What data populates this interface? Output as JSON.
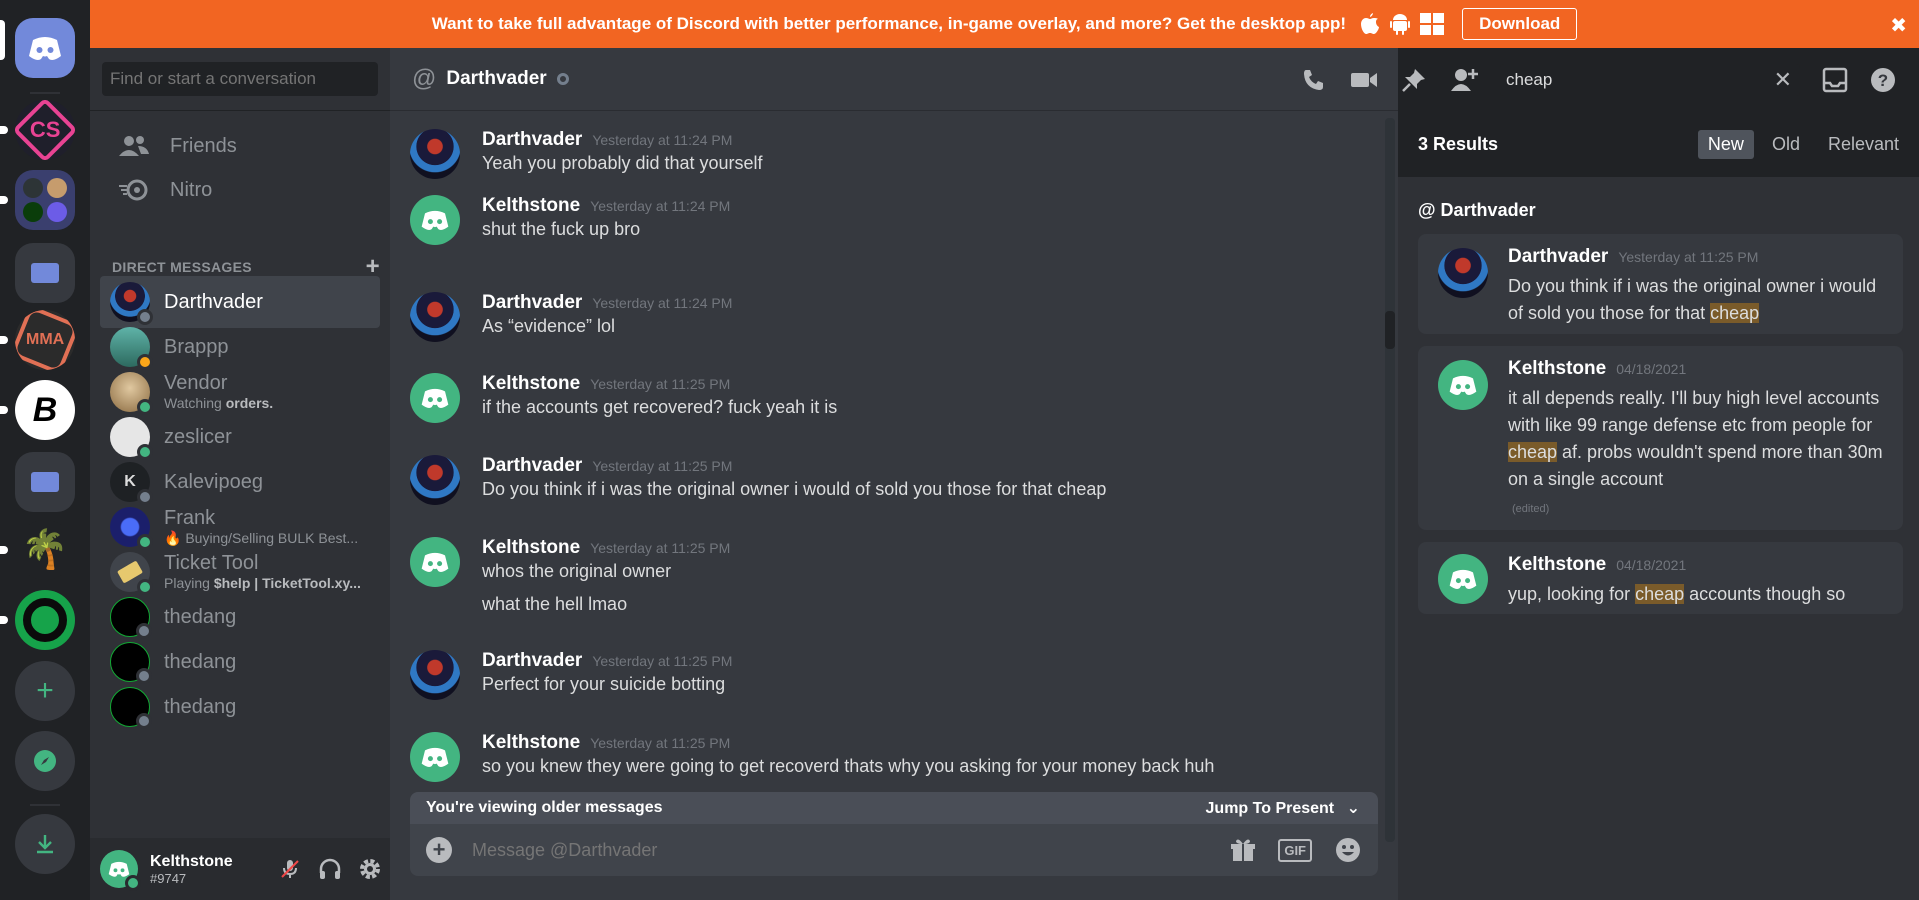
{
  "banner": {
    "text": "Want to take full advantage of Discord with better performance, in-game overlay, and more? Get the desktop app!",
    "download_label": "Download",
    "close_glyph": "✖"
  },
  "guilds": {
    "items": [
      {
        "name": "home"
      },
      {
        "name": "CS",
        "label": "CS"
      },
      {
        "name": "folder-grid"
      },
      {
        "name": "folder"
      },
      {
        "name": "MMA",
        "label": "MMA"
      },
      {
        "name": "B",
        "label": "B"
      },
      {
        "name": "folder-2"
      },
      {
        "name": "palm"
      },
      {
        "name": "ring"
      }
    ],
    "add_glyph": "+",
    "explore_icon": "compass-icon",
    "download_icon": "download-icon"
  },
  "sidebar": {
    "search_placeholder": "Find or start a conversation",
    "friends_label": "Friends",
    "nitro_label": "Nitro",
    "dm_header": "DIRECT MESSAGES",
    "dm_add": "+",
    "dms": [
      {
        "name": "Darthvader",
        "sub": "",
        "status": "#747f8d"
      },
      {
        "name": "Brappp",
        "sub": "",
        "status": "#faa61a"
      },
      {
        "name": "Vendor",
        "sub_prefix": "Watching ",
        "sub_bold": "orders.",
        "status": "#43b581"
      },
      {
        "name": "zeslicer",
        "sub": "",
        "status": "#43b581"
      },
      {
        "name": "Kalevipoeg",
        "sub": "",
        "status": "#747f8d"
      },
      {
        "name": "Frank",
        "sub": "🔥 Buying/Selling BULK Best...",
        "status": "#43b581"
      },
      {
        "name": "Ticket Tool",
        "sub_prefix": "Playing ",
        "sub_bold": "$help | TicketTool.xy...",
        "status": "#43b581"
      },
      {
        "name": "thedang",
        "sub": "",
        "status": "#747f8d"
      },
      {
        "name": "thedang",
        "sub": "",
        "status": "#747f8d"
      },
      {
        "name": "thedang",
        "sub": "",
        "status": "#747f8d"
      }
    ],
    "user": {
      "name": "Kelthstone",
      "tag": "#9747"
    }
  },
  "chat": {
    "channel": "Darthvader",
    "messages": [
      {
        "author": "Darthvader",
        "ts": "Yesterday at 11:24 PM",
        "body": "Yeah you probably did that yourself"
      },
      {
        "author": "Kelthstone",
        "ts": "Yesterday at 11:24 PM",
        "body": "shut the fuck up bro"
      },
      {
        "author": "Darthvader",
        "ts": "Yesterday at 11:24 PM",
        "body": "As “evidence” lol"
      },
      {
        "author": "Kelthstone",
        "ts": "Yesterday at 11:25 PM",
        "body": "if the accounts get recovered? fuck yeah it is"
      },
      {
        "author": "Darthvader",
        "ts": "Yesterday at 11:25 PM",
        "body": "Do you think if i was the original owner i would of sold you those for that cheap"
      },
      {
        "author": "Kelthstone",
        "ts": "Yesterday at 11:25 PM",
        "body": "whos the original owner",
        "body2": "what the hell lmao"
      },
      {
        "author": "Darthvader",
        "ts": "Yesterday at 11:25 PM",
        "body": "Perfect for your suicide botting"
      },
      {
        "author": "Kelthstone",
        "ts": "Yesterday at 11:25 PM",
        "body": "so you knew they were going to get recoverd thats why you asking for your money back huh"
      }
    ],
    "older_notice": "You're viewing older messages",
    "jump_label": "Jump To Present",
    "composer_placeholder": "Message @Darthvader",
    "gif_label": "GIF"
  },
  "search": {
    "query": "cheap",
    "results_count": "3 Results",
    "sort": [
      "New",
      "Old",
      "Relevant"
    ],
    "channel": "@ Darthvader",
    "results": [
      {
        "author": "Darthvader",
        "ts": "Yesterday at 11:25 PM",
        "before": "Do you think if i was the original owner i would of sold you those for that ",
        "hit": "cheap",
        "after": ""
      },
      {
        "author": "Kelthstone",
        "ts": "04/18/2021",
        "before": "it all depends really. I'll buy high level accounts with like 99 range defense etc from people for ",
        "hit": "cheap",
        "after": " af. probs wouldn't spend more than 30m on a single account",
        "edited": "(edited)"
      },
      {
        "author": "Kelthstone",
        "ts": "04/18/2021",
        "before": "yup, looking for ",
        "hit": "cheap",
        "after": " accounts though so"
      }
    ]
  },
  "colors": {
    "accent": "#7289da",
    "banner": "#f26522",
    "online": "#43b581",
    "idle": "#faa61a",
    "offline": "#747f8d",
    "highlight": "#7a5b2a"
  }
}
